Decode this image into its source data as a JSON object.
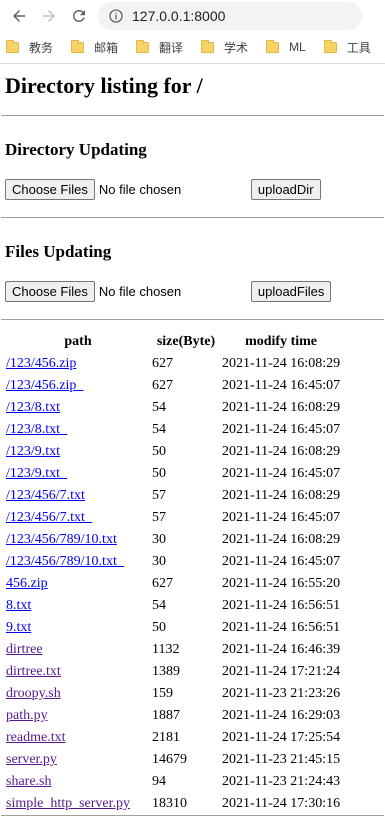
{
  "browser": {
    "url": "127.0.0.1:8000",
    "bookmarks": [
      {
        "label": "教务"
      },
      {
        "label": "邮箱"
      },
      {
        "label": "翻译"
      },
      {
        "label": "学术"
      },
      {
        "label": "ML"
      },
      {
        "label": "工具"
      }
    ]
  },
  "page": {
    "title": "Directory listing for /",
    "dir_section": {
      "heading": "Directory Updating",
      "choose_label": "Choose Files",
      "no_file": "No file chosen",
      "upload_label": "uploadDir"
    },
    "files_section": {
      "heading": "Files Updating",
      "choose_label": "Choose Files",
      "no_file": "No file chosen",
      "upload_label": "uploadFiles"
    },
    "table": {
      "headers": [
        "path",
        "size(Byte)",
        "modify time"
      ],
      "rows": [
        {
          "path": "/123/456.zip",
          "size": "627",
          "time": "2021-11-24 16:08:29",
          "visited": false
        },
        {
          "path": "/123/456.zip_",
          "size": "627",
          "time": "2021-11-24 16:45:07",
          "visited": false
        },
        {
          "path": "/123/8.txt",
          "size": "54",
          "time": "2021-11-24 16:08:29",
          "visited": false
        },
        {
          "path": "/123/8.txt_",
          "size": "54",
          "time": "2021-11-24 16:45:07",
          "visited": false
        },
        {
          "path": "/123/9.txt",
          "size": "50",
          "time": "2021-11-24 16:08:29",
          "visited": false
        },
        {
          "path": "/123/9.txt_",
          "size": "50",
          "time": "2021-11-24 16:45:07",
          "visited": false
        },
        {
          "path": "/123/456/7.txt",
          "size": "57",
          "time": "2021-11-24 16:08:29",
          "visited": false
        },
        {
          "path": "/123/456/7.txt_",
          "size": "57",
          "time": "2021-11-24 16:45:07",
          "visited": false
        },
        {
          "path": "/123/456/789/10.txt",
          "size": "30",
          "time": "2021-11-24 16:08:29",
          "visited": false
        },
        {
          "path": "/123/456/789/10.txt_",
          "size": "30",
          "time": "2021-11-24 16:45:07",
          "visited": false
        },
        {
          "path": "456.zip",
          "size": "627",
          "time": "2021-11-24 16:55:20",
          "visited": false
        },
        {
          "path": "8.txt",
          "size": "54",
          "time": "2021-11-24 16:56:51",
          "visited": false
        },
        {
          "path": "9.txt",
          "size": "50",
          "time": "2021-11-24 16:56:51",
          "visited": false
        },
        {
          "path": "dirtree",
          "size": "1132",
          "time": "2021-11-24 16:46:39",
          "visited": true
        },
        {
          "path": "dirtree.txt",
          "size": "1389",
          "time": "2021-11-24 17:21:24",
          "visited": true
        },
        {
          "path": "droopy.sh",
          "size": "159",
          "time": "2021-11-23 21:23:26",
          "visited": true
        },
        {
          "path": "path.py",
          "size": "1887",
          "time": "2021-11-24 16:29:03",
          "visited": true
        },
        {
          "path": "readme.txt",
          "size": "2181",
          "time": "2021-11-24 17:25:54",
          "visited": true
        },
        {
          "path": "server.py",
          "size": "14679",
          "time": "2021-11-23 21:45:15",
          "visited": true
        },
        {
          "path": "share.sh",
          "size": "94",
          "time": "2021-11-23 21:24:43",
          "visited": true
        },
        {
          "path": "simple_http_server.py",
          "size": "18310",
          "time": "2021-11-24 17:30:16",
          "visited": true
        }
      ]
    }
  },
  "colors": {
    "link": "#0000ee",
    "visited": "#551a8b"
  }
}
